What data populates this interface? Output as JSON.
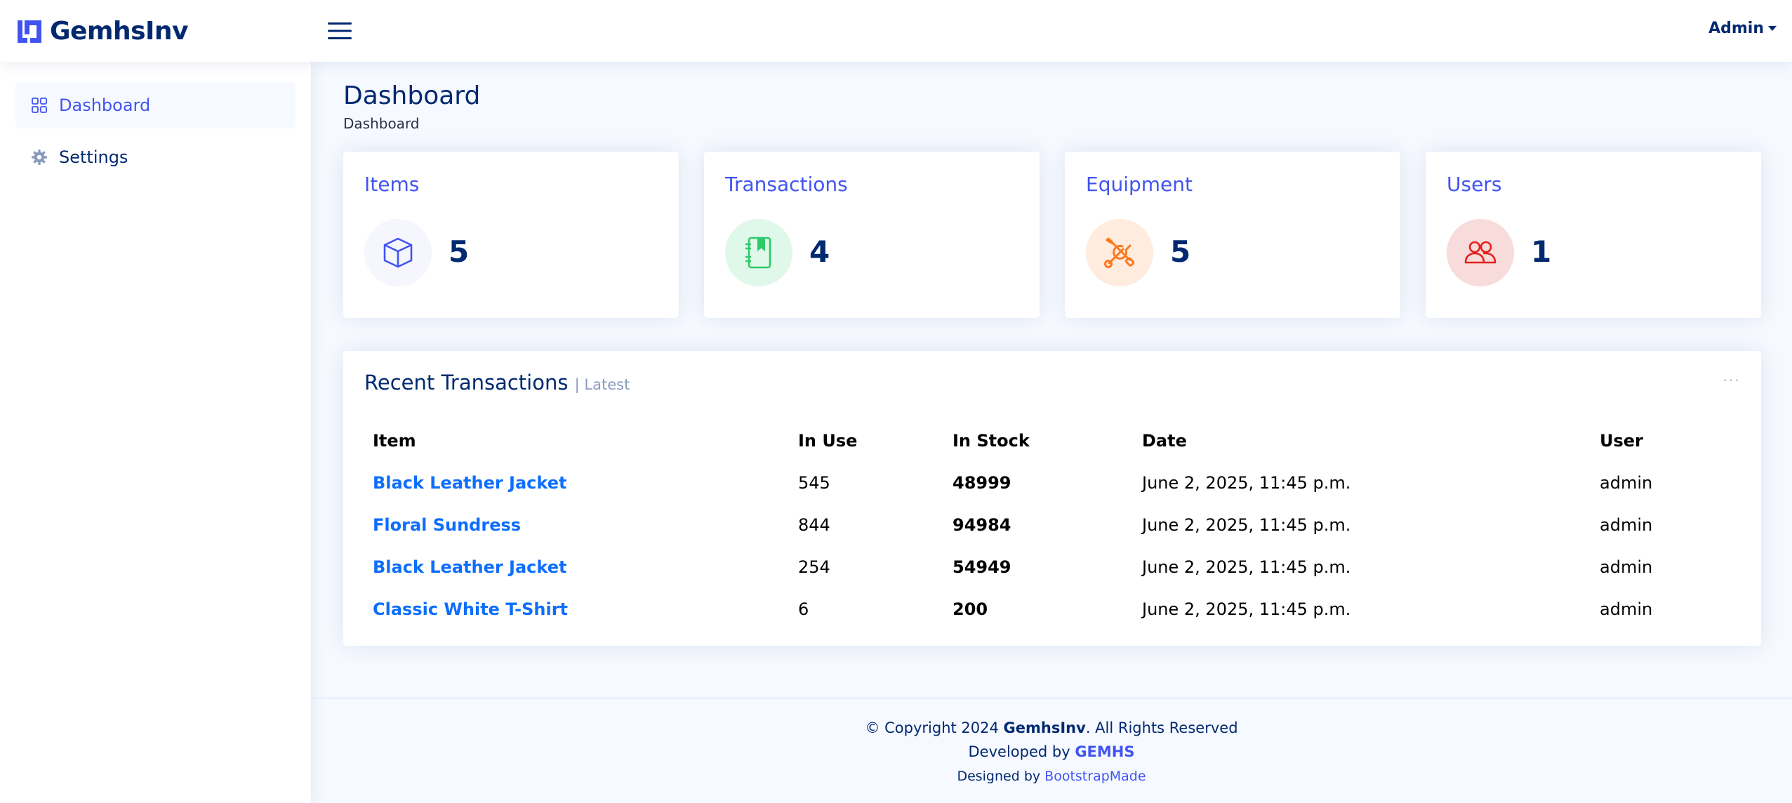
{
  "app": {
    "logo_text": "GemhsInv",
    "user_menu": "Admin"
  },
  "sidebar": {
    "items": [
      {
        "label": "Dashboard",
        "icon": "grid-icon",
        "active": true
      },
      {
        "label": "Settings",
        "icon": "gear-icon",
        "active": false
      }
    ]
  },
  "page": {
    "title": "Dashboard",
    "breadcrumb": "Dashboard"
  },
  "stats": [
    {
      "title": "Items",
      "value": "5",
      "icon": "box-icon",
      "color": "#4154f1",
      "bg": "#f6f6fe"
    },
    {
      "title": "Transactions",
      "value": "4",
      "icon": "journal-bookmark-icon",
      "color": "#2eca6a",
      "bg": "#e0f8e9"
    },
    {
      "title": "Equipment",
      "value": "5",
      "icon": "tools-icon",
      "color": "#ff771d",
      "bg": "#ffecdf"
    },
    {
      "title": "Users",
      "value": "1",
      "icon": "people-icon",
      "color": "#e5201b",
      "bg": "#f8dbdb"
    }
  ],
  "recent": {
    "title": "Recent Transactions",
    "subtitle": "| Latest",
    "more": "···",
    "columns": [
      "Item",
      "In Use",
      "In Stock",
      "Date",
      "User"
    ],
    "rows": [
      {
        "item": "Black Leather Jacket",
        "in_use": "545",
        "in_stock": "48999",
        "date": "June 2, 2025, 11:45 p.m.",
        "user": "admin"
      },
      {
        "item": "Floral Sundress",
        "in_use": "844",
        "in_stock": "94984",
        "date": "June 2, 2025, 11:45 p.m.",
        "user": "admin"
      },
      {
        "item": "Black Leather Jacket",
        "in_use": "254",
        "in_stock": "54949",
        "date": "June 2, 2025, 11:45 p.m.",
        "user": "admin"
      },
      {
        "item": "Classic White T-Shirt",
        "in_use": "6",
        "in_stock": "200",
        "date": "June 2, 2025, 11:45 p.m.",
        "user": "admin"
      }
    ]
  },
  "footer": {
    "copyright_prefix": "© Copyright 2024 ",
    "copyright_brand": "GemhsInv",
    "copyright_suffix": ". All Rights Reserved",
    "developed_prefix": "Developed by ",
    "developed_brand": "GEMHS",
    "designed_prefix": "Designed by ",
    "designed_link": "BootstrapMade"
  },
  "colors": {
    "primary": "#4154f1",
    "navy": "#012970",
    "link": "#0d6efd",
    "background": "#f6f9ff"
  }
}
